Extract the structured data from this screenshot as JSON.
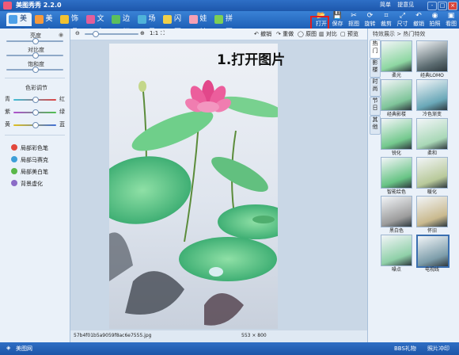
{
  "title_bar": {
    "app_title": "美图秀秀 2.2.0",
    "links": [
      "简单",
      "提意见"
    ],
    "window_buttons": [
      "-",
      "□",
      "×"
    ]
  },
  "main_tabs": [
    {
      "label": "美化",
      "active": true,
      "icon": "palette-icon",
      "color": "#4da0e8"
    },
    {
      "label": "美容",
      "active": false,
      "icon": "face-icon",
      "color": "#f59a3c"
    },
    {
      "label": "饰品",
      "active": false,
      "icon": "sticker-icon",
      "color": "#f2c230"
    },
    {
      "label": "文字",
      "active": false,
      "icon": "text-icon",
      "color": "#e25e9a"
    },
    {
      "label": "边框",
      "active": false,
      "icon": "frame-icon",
      "color": "#5cbf5c"
    },
    {
      "label": "场景",
      "active": false,
      "icon": "scene-icon",
      "color": "#4fb3d9"
    },
    {
      "label": "闪图",
      "active": false,
      "icon": "flash-icon",
      "color": "#f0d04a"
    },
    {
      "label": "娃娃",
      "active": false,
      "icon": "doll-icon",
      "color": "#f5a0b4"
    },
    {
      "label": "拼图",
      "active": false,
      "icon": "puzzle-icon",
      "color": "#7dcf55"
    }
  ],
  "toolbar": [
    {
      "label": "打开",
      "icon": "folder-open-icon"
    },
    {
      "label": "保存",
      "icon": "save-icon"
    },
    {
      "label": "抠图",
      "icon": "cutout-icon"
    },
    {
      "label": "旋转",
      "icon": "rotate-icon"
    },
    {
      "label": "裁剪",
      "icon": "crop-icon"
    },
    {
      "label": "尺寸",
      "icon": "resize-icon"
    },
    {
      "label": "撤销",
      "icon": "undo-icon"
    },
    {
      "label": "拍照",
      "icon": "camera-icon"
    },
    {
      "label": "看图",
      "icon": "view-icon"
    }
  ],
  "left_panel": {
    "adjustments": [
      {
        "label": "亮度",
        "value": 0.5
      },
      {
        "label": "对比度",
        "value": 0.5
      },
      {
        "label": "饱和度",
        "value": 0.5
      }
    ],
    "color_section_title": "色彩调节",
    "color_sliders": [
      {
        "left": "青",
        "right": "红",
        "value": 0.5
      },
      {
        "left": "紫",
        "right": "绿",
        "value": 0.5
      },
      {
        "left": "黄",
        "right": "蓝",
        "value": 0.5
      }
    ],
    "brushes": [
      {
        "label": "局部彩色笔",
        "color": "#e2483c"
      },
      {
        "label": "局部马赛克",
        "color": "#3e9fd8"
      },
      {
        "label": "局部美白笔",
        "color": "#5ab84a"
      },
      {
        "label": "背景虚化",
        "color": "#8b6cc7"
      }
    ]
  },
  "canvas_toolbar": {
    "zoom_fit": "1:1",
    "undo": "撤销",
    "redo": "重做",
    "original": "原图",
    "compare": "对比",
    "preview": "预览"
  },
  "photo_caption": "1.打开图片",
  "file_name": "57b4f01b5a9059f8ac6e7555.jpg",
  "image_size": "553 × 800",
  "right_panel": {
    "breadcrumb": "特效展示 > 热门特效",
    "vertical_tabs": [
      {
        "label": "热门",
        "active": true
      },
      {
        "label": "影楼",
        "active": false
      },
      {
        "label": "时尚",
        "active": false
      },
      {
        "label": "节日",
        "active": false
      },
      {
        "label": "其他",
        "active": false
      }
    ],
    "effects": [
      {
        "label": "柔光",
        "selected": false
      },
      {
        "label": "经典LOMO",
        "selected": false
      },
      {
        "label": "经典影楼",
        "selected": false
      },
      {
        "label": "冷色渐变",
        "selected": false
      },
      {
        "label": "锐化",
        "selected": false
      },
      {
        "label": "柔和",
        "selected": false
      },
      {
        "label": "智能绘色",
        "selected": false
      },
      {
        "label": "暖化",
        "selected": false
      },
      {
        "label": "黑白色",
        "selected": false
      },
      {
        "label": "怀旧",
        "selected": false
      },
      {
        "label": "噪点",
        "selected": false
      },
      {
        "label": "电视线",
        "selected": true
      }
    ]
  },
  "status_bar": {
    "left_label": "美图网",
    "right_items": [
      "BBS礼物",
      "照片冲印"
    ]
  }
}
